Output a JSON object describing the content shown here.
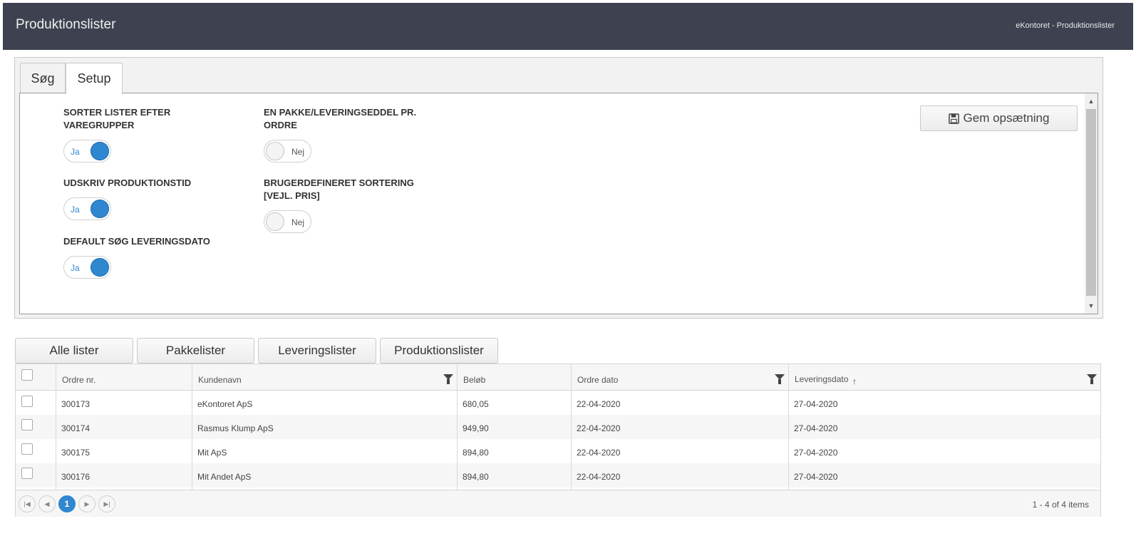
{
  "header": {
    "title": "Produktionslister",
    "breadcrumb": "eKontoret - Produktionslister"
  },
  "tabs": [
    {
      "label": "Søg",
      "selected": false
    },
    {
      "label": "Setup",
      "selected": true
    }
  ],
  "setup": {
    "save_button": "Gem opsætning",
    "options": [
      {
        "label": "SORTER LISTER EFTER VAREGRUPPER",
        "state": "Ja",
        "on": true
      },
      {
        "label": "UDSKRIV PRODUKTIONSTID",
        "state": "Ja",
        "on": true
      },
      {
        "label": "DEFAULT SØG LEVERINGSDATO",
        "state": "Ja",
        "on": true
      },
      {
        "label": "EN PAKKE/LEVERINGSEDDEL PR. ORDRE",
        "state": "Nej",
        "on": false
      },
      {
        "label": "BRUGERDEFINERET SORTERING [VEJL. PRIS]",
        "state": "Nej",
        "on": false
      }
    ]
  },
  "list_buttons": [
    "Alle lister",
    "Pakkelister",
    "Leveringslister",
    "Produktionslister"
  ],
  "grid": {
    "columns": [
      "Ordre nr.",
      "Kundenavn",
      "Beløb",
      "Ordre dato",
      "Leveringsdato"
    ],
    "sort_indicator": "↑",
    "rows": [
      [
        "300173",
        "eKontoret ApS",
        "680,05",
        "22-04-2020",
        "27-04-2020"
      ],
      [
        "300174",
        "Rasmus Klump ApS",
        "949,90",
        "22-04-2020",
        "27-04-2020"
      ],
      [
        "300175",
        "Mit ApS",
        "894,80",
        "22-04-2020",
        "27-04-2020"
      ],
      [
        "300176",
        "Mit Andet ApS",
        "894,80",
        "22-04-2020",
        "27-04-2020"
      ]
    ],
    "pager": {
      "current_page": "1",
      "info": "1 - 4 of 4 items"
    }
  },
  "colors": {
    "header_bg": "#3e4250",
    "accent": "#2f87cf"
  }
}
